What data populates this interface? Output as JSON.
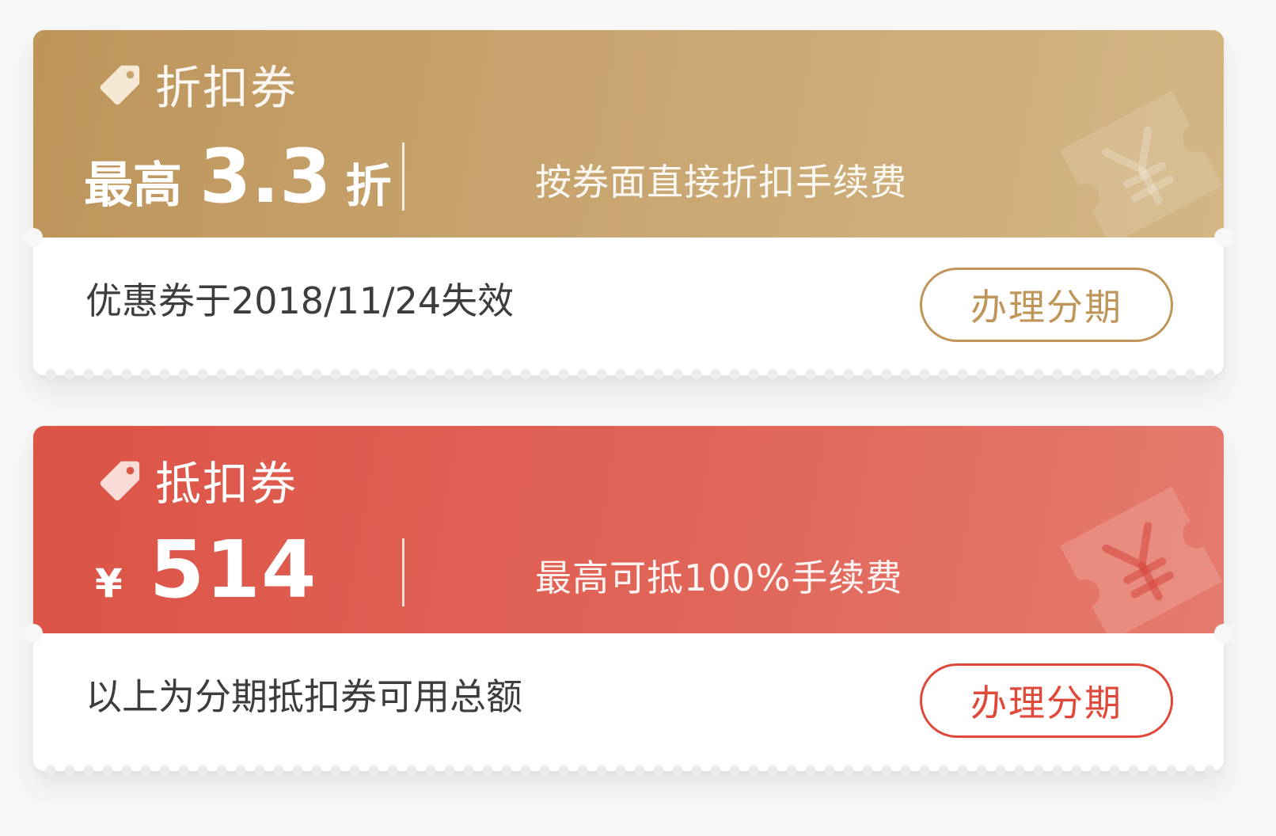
{
  "coupons": [
    {
      "type_label": "折扣券",
      "value_prefix": "最高",
      "value": "3.3",
      "value_suffix": "折",
      "description": "按券面直接折扣手续费",
      "note": "优惠券于2018/11/24失效",
      "button_label": "办理分期",
      "accent_color": "#bf955a",
      "tag_icon": "price-tag-icon",
      "watermark_icon": "yen-ticket-icon"
    },
    {
      "type_label": "抵扣券",
      "value_prefix": "¥",
      "value": "514",
      "value_suffix": "",
      "description": "最高可抵100%手续费",
      "note": "以上为分期抵扣券可用总额",
      "button_label": "办理分期",
      "accent_color": "#e0483a",
      "tag_icon": "price-tag-icon",
      "watermark_icon": "yen-ticket-icon"
    }
  ]
}
